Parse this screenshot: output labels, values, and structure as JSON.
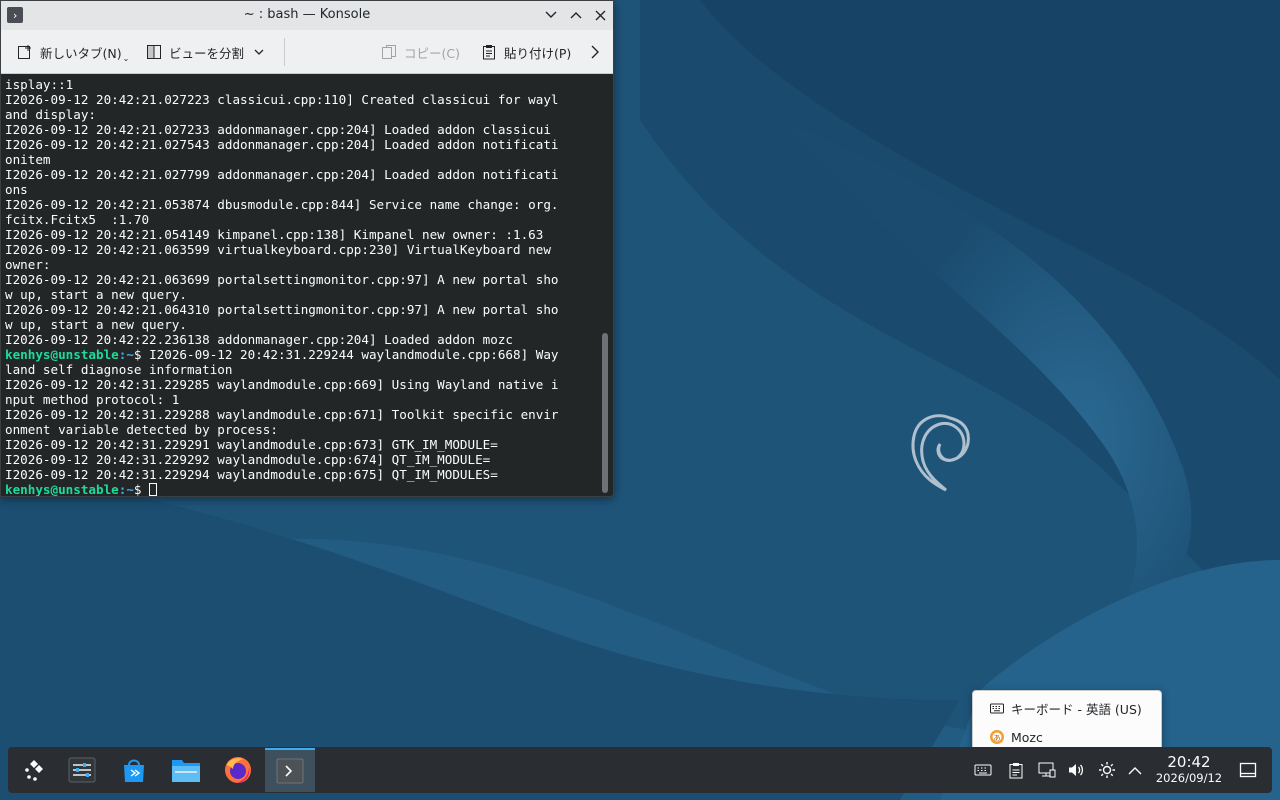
{
  "window": {
    "title": "~ : bash — Konsole",
    "minimize_glyph": "⌄",
    "maximize_glyph": "⌃",
    "close_glyph": "✕"
  },
  "toolbar": {
    "new_tab": "新しいタブ(N)",
    "split_view": "ビューを分割",
    "copy": "コピー(C)",
    "paste": "貼り付け(P)"
  },
  "terminal": {
    "lines": [
      {
        "text": "isplay::1"
      },
      {
        "text": "I2026-09-12 20:42:21.027223 classicui.cpp:110] Created classicui for wayl"
      },
      {
        "text": "and display:"
      },
      {
        "text": "I2026-09-12 20:42:21.027233 addonmanager.cpp:204] Loaded addon classicui"
      },
      {
        "text": "I2026-09-12 20:42:21.027543 addonmanager.cpp:204] Loaded addon notificati"
      },
      {
        "text": "onitem"
      },
      {
        "text": "I2026-09-12 20:42:21.027799 addonmanager.cpp:204] Loaded addon notificati"
      },
      {
        "text": "ons"
      },
      {
        "text": "I2026-09-12 20:42:21.053874 dbusmodule.cpp:844] Service name change: org."
      },
      {
        "text": "fcitx.Fcitx5  :1.70"
      },
      {
        "text": "I2026-09-12 20:42:21.054149 kimpanel.cpp:138] Kimpanel new owner: :1.63"
      },
      {
        "text": "I2026-09-12 20:42:21.063599 virtualkeyboard.cpp:230] VirtualKeyboard new"
      },
      {
        "text": "owner:"
      },
      {
        "text": "I2026-09-12 20:42:21.063699 portalsettingmonitor.cpp:97] A new portal sho"
      },
      {
        "text": "w up, start a new query."
      },
      {
        "text": "I2026-09-12 20:42:21.064310 portalsettingmonitor.cpp:97] A new portal sho"
      },
      {
        "text": "w up, start a new query."
      },
      {
        "text": "I2026-09-12 20:42:22.236138 addonmanager.cpp:204] Loaded addon mozc"
      },
      {
        "prompt_user": "kenhys@unstable",
        "prompt_path": ":~",
        "text": "$ I2026-09-12 20:42:31.229244 waylandmodule.cpp:668] Way"
      },
      {
        "text": "land self diagnose information"
      },
      {
        "text": "I2026-09-12 20:42:31.229285 waylandmodule.cpp:669] Using Wayland native i"
      },
      {
        "text": "nput method protocol: 1"
      },
      {
        "text": "I2026-09-12 20:42:31.229288 waylandmodule.cpp:671] Toolkit specific envir"
      },
      {
        "text": "onment variable detected by process:"
      },
      {
        "text": "I2026-09-12 20:42:31.229291 waylandmodule.cpp:673] GTK_IM_MODULE="
      },
      {
        "text": "I2026-09-12 20:42:31.229292 waylandmodule.cpp:674] QT_IM_MODULE="
      },
      {
        "text": "I2026-09-12 20:42:31.229294 waylandmodule.cpp:675] QT_IM_MODULES="
      },
      {
        "prompt_user": "kenhys@unstable",
        "prompt_path": ":~",
        "text": "$ ",
        "cursor": true
      }
    ]
  },
  "im_popup": {
    "items": [
      {
        "label": "キーボード - 英語 (US)",
        "icon": "keyboard-icon"
      },
      {
        "label": "Mozc",
        "icon": "mozc-icon"
      }
    ]
  },
  "taskbar": {
    "apps": [
      {
        "name": "application-launcher",
        "icon": "kde-launcher-icon"
      },
      {
        "name": "system-settings",
        "icon": "settings-icon"
      },
      {
        "name": "discover",
        "icon": "store-icon"
      },
      {
        "name": "dolphin",
        "icon": "folder-icon"
      },
      {
        "name": "firefox",
        "icon": "firefox-icon"
      },
      {
        "name": "konsole",
        "icon": "terminal-icon",
        "active": true
      }
    ],
    "clock": {
      "time": "20:42",
      "date": "2026/09/12"
    }
  },
  "colors": {
    "accent": "#3daee9",
    "prompt_user": "#1cdc9a",
    "terminal_bg": "#232627",
    "panel_bg": "#2a2e32",
    "wallpaper_dark": "#173f5e",
    "wallpaper_mid": "#245f87"
  }
}
